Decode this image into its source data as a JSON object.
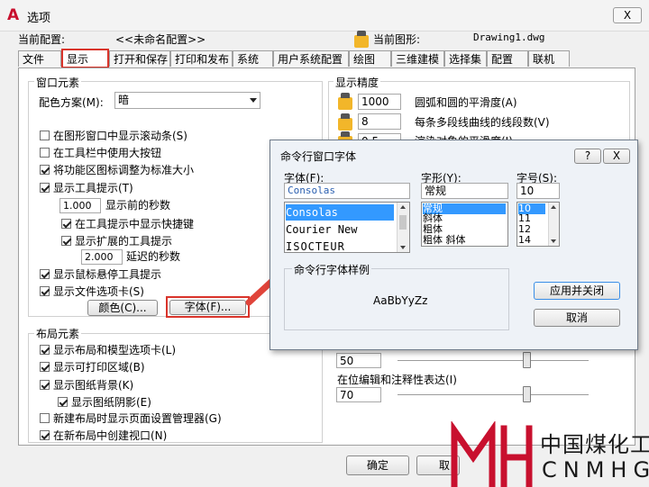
{
  "window": {
    "title": "选项",
    "close_label": "X"
  },
  "config": {
    "current_profile_label": "当前配置:",
    "current_profile_value": "<<未命名配置>>",
    "current_drawing_label": "当前图形:",
    "current_drawing_value": "Drawing1.dwg"
  },
  "tabs": [
    "文件",
    "显示",
    "打开和保存",
    "打印和发布",
    "系统",
    "用户系统配置",
    "绘图",
    "三维建模",
    "选择集",
    "配置",
    "联机"
  ],
  "window_elements": {
    "title": "窗口元素",
    "color_scheme_label": "配色方案(M):",
    "color_scheme_value": "暗",
    "checks": [
      {
        "label": "在图形窗口中显示滚动条(S)",
        "checked": false
      },
      {
        "label": "在工具栏中使用大按钮",
        "checked": false
      },
      {
        "label": "将功能区图标调整为标准大小",
        "checked": true
      },
      {
        "label": "显示工具提示(T)",
        "checked": true
      }
    ],
    "tooltip_delay_value": "1.000",
    "tooltip_delay_label": "显示前的秒数",
    "sub_checks": [
      {
        "label": "在工具提示中显示快捷键",
        "checked": true
      },
      {
        "label": "显示扩展的工具提示",
        "checked": true
      }
    ],
    "ext_delay_value": "2.000",
    "ext_delay_label": "延迟的秒数",
    "checks2": [
      {
        "label": "显示鼠标悬停工具提示",
        "checked": true
      },
      {
        "label": "显示文件选项卡(S)",
        "checked": true
      }
    ],
    "color_button": "颜色(C)...",
    "font_button": "字体(F)..."
  },
  "layout_elements": {
    "title": "布局元素",
    "checks": [
      {
        "label": "显示布局和模型选项卡(L)",
        "checked": true
      },
      {
        "label": "显示可打印区域(B)",
        "checked": true
      },
      {
        "label": "显示图纸背景(K)",
        "checked": true
      }
    ],
    "sub_check": {
      "label": "显示图纸阴影(E)",
      "checked": true
    },
    "checks2": [
      {
        "label": "新建布局时显示页面设置管理器(G)",
        "checked": false
      },
      {
        "label": "在新布局中创建视口(N)",
        "checked": true
      }
    ]
  },
  "display_precision": {
    "title": "显示精度",
    "rows": [
      {
        "value": "1000",
        "label": "圆弧和圆的平滑度(A)"
      },
      {
        "value": "8",
        "label": "每条多段线曲线的线段数(V)"
      },
      {
        "value": "0.5",
        "label": "渲染对象的平滑度(J)"
      }
    ]
  },
  "fade": {
    "first_value": "50",
    "inplace_label": "在位编辑和注释性表达(I)",
    "inplace_value": "70"
  },
  "bottom_buttons": {
    "ok": "确定",
    "cancel": "取消"
  },
  "font_dialog": {
    "title": "命令行窗口字体",
    "help": "?",
    "close": "X",
    "font_label": "字体(F):",
    "font_value": "Consolas",
    "fonts": [
      "Consolas",
      "Courier New",
      "ISOCTEUR"
    ],
    "style_label": "字形(Y):",
    "style_value": "常规",
    "styles": [
      "常规",
      "斜体",
      "粗体",
      "粗体 斜体"
    ],
    "size_label": "字号(S):",
    "size_value": "10",
    "sizes": [
      "10",
      "11",
      "12",
      "14"
    ],
    "sample_label": "命令行字体样例",
    "sample_text": "AaBbYyZz",
    "apply_button": "应用并关闭",
    "cancel_button": "取消"
  },
  "watermark": {
    "brand_cn": "中国煤化工",
    "brand_en": "CNMHG"
  },
  "colors": {
    "accent_red": "#d9342b",
    "selection_blue": "#3399ff",
    "logo_red": "#c8102e"
  }
}
